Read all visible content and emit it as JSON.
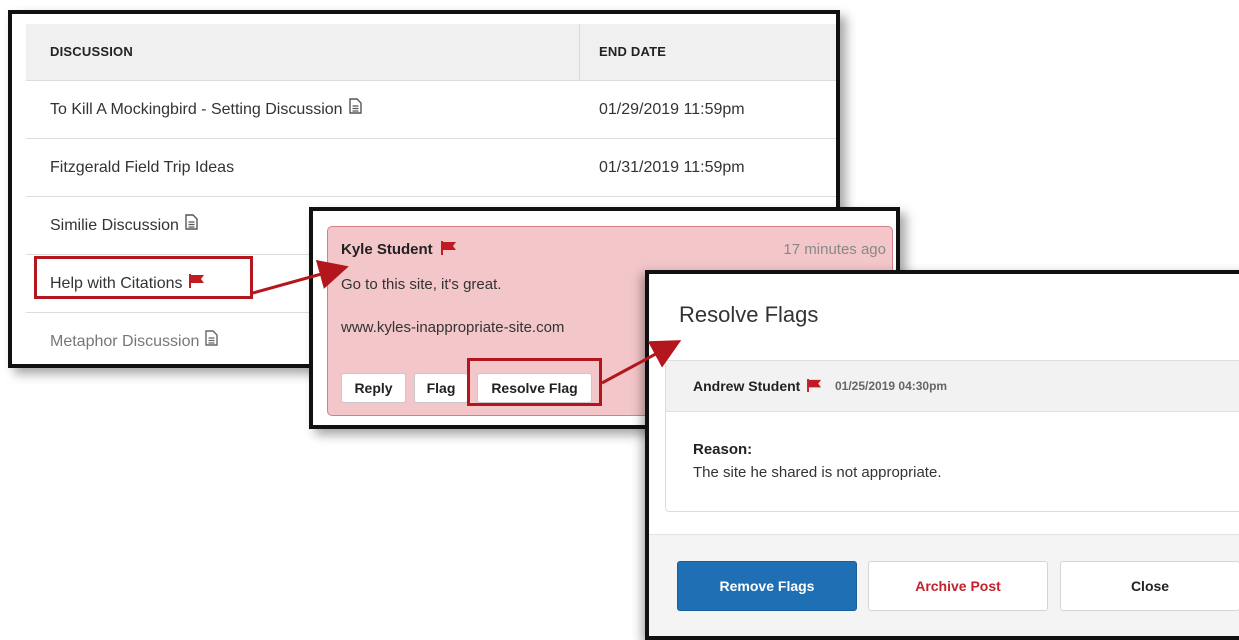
{
  "discussion_list": {
    "columns": {
      "discussion": "DISCUSSION",
      "end_date": "END DATE"
    },
    "rows": [
      {
        "title": "To Kill A Mockingbird - Setting Discussion",
        "end_date": "01/29/2019 11:59pm",
        "icon": "document-icon"
      },
      {
        "title": "Fitzgerald Field Trip Ideas",
        "end_date": "01/31/2019 11:59pm",
        "icon": ""
      },
      {
        "title": "Similie Discussion",
        "end_date": "",
        "icon": "document-icon"
      },
      {
        "title": "Help with Citations",
        "end_date": "",
        "icon": "flag-icon"
      },
      {
        "title": "Metaphor Discussion",
        "end_date": "",
        "icon": "document-icon"
      }
    ]
  },
  "post": {
    "author": "Kyle Student",
    "time": "17 minutes ago",
    "body": "Go to this site, it's great.",
    "link": "www.kyles-inappropriate-site.com",
    "buttons": {
      "reply": "Reply",
      "flag": "Flag",
      "resolve": "Resolve Flag"
    }
  },
  "resolve_dialog": {
    "title": "Resolve Flags",
    "flag": {
      "author": "Andrew Student",
      "date": "01/25/2019 04:30pm",
      "reason_label": "Reason:",
      "reason": "The site he shared is not appropriate."
    },
    "buttons": {
      "remove": "Remove Flags",
      "archive": "Archive Post",
      "close": "Close"
    }
  },
  "colors": {
    "flag": "#c21a21",
    "highlight": "#b3171d",
    "post_background": "#f3c6c9",
    "primary_button": "#1f6fb5"
  }
}
